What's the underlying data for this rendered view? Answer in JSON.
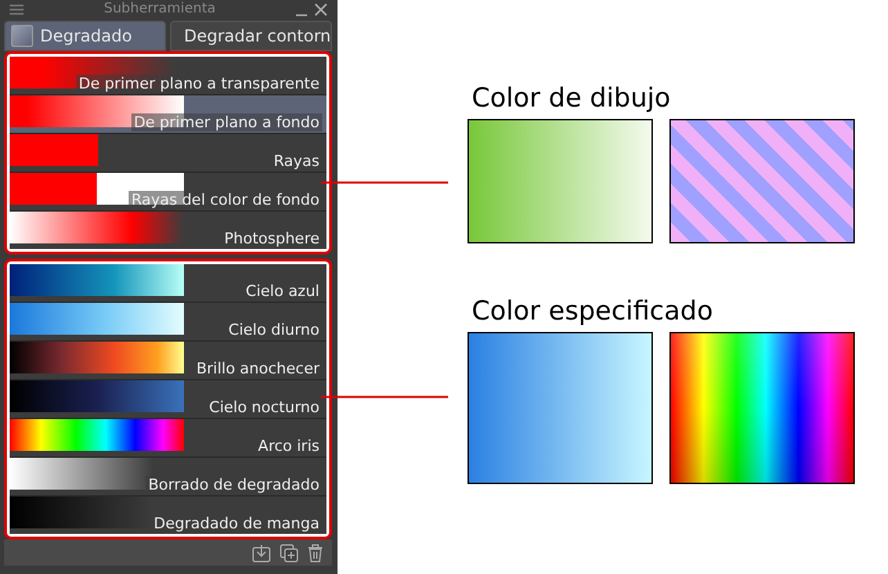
{
  "panel": {
    "title": "Subherramienta",
    "tabs": [
      {
        "label": "Degradado",
        "selected": true,
        "kind": "gradient"
      },
      {
        "label": "Degradar contorn",
        "selected": false,
        "kind": "contour"
      }
    ],
    "groups": [
      {
        "rows": [
          {
            "label": "De primer plano a transparente",
            "kind": "fg-transparent",
            "selected": false
          },
          {
            "label": "De primer plano a fondo",
            "kind": "fg-bg",
            "selected": true
          },
          {
            "label": "Rayas",
            "kind": "stripes",
            "selected": false
          },
          {
            "label": "Rayas del color de fondo",
            "kind": "bg-stripes",
            "selected": false
          },
          {
            "label": "Photosphere",
            "kind": "photosphere",
            "selected": false
          }
        ]
      },
      {
        "rows": [
          {
            "label": "Cielo azul",
            "kind": "blue-sky",
            "selected": false
          },
          {
            "label": "Cielo diurno",
            "kind": "day-sky",
            "selected": false
          },
          {
            "label": "Brillo anochecer",
            "kind": "dusk",
            "selected": false
          },
          {
            "label": "Cielo nocturno",
            "kind": "night-sky",
            "selected": false
          },
          {
            "label": "Arco iris",
            "kind": "rainbow",
            "selected": false
          },
          {
            "label": "Borrado de degradado",
            "kind": "erase",
            "selected": false
          },
          {
            "label": "Degradado de manga",
            "kind": "manga",
            "selected": false
          }
        ]
      }
    ]
  },
  "legend": [
    {
      "title": "Color de dibujo",
      "swatches": [
        {
          "kind": "green-fade"
        },
        {
          "kind": "lilac-stripes"
        }
      ]
    },
    {
      "title": "Color especificado",
      "swatches": [
        {
          "kind": "blue-fade"
        },
        {
          "kind": "rainbow"
        }
      ]
    }
  ]
}
